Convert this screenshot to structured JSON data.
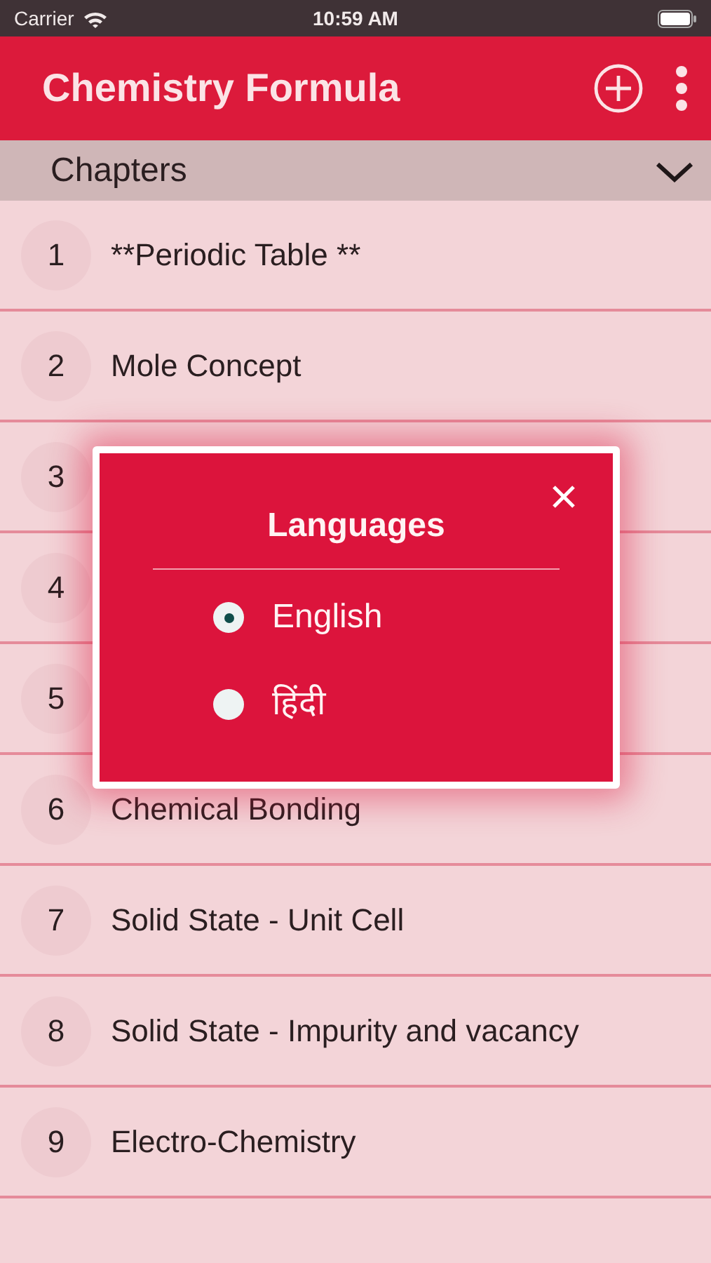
{
  "status_bar": {
    "carrier": "Carrier",
    "time": "10:59 AM"
  },
  "app_bar": {
    "title": "Chemistry Formula"
  },
  "section": {
    "title": "Chapters",
    "expanded": true
  },
  "chapters": [
    {
      "number": "1",
      "title": "**Periodic Table **"
    },
    {
      "number": "2",
      "title": "Mole Concept"
    },
    {
      "number": "3"
    },
    {
      "number": "4"
    },
    {
      "number": "5"
    },
    {
      "number": "6",
      "title": "Chemical Bonding"
    },
    {
      "number": "7",
      "title": "Solid State - Unit Cell"
    },
    {
      "number": "8",
      "title": "Solid State - Impurity and vacancy"
    },
    {
      "number": "9",
      "title": "Electro-Chemistry"
    }
  ],
  "dialog": {
    "title": "Languages",
    "options": [
      {
        "label": "English",
        "selected": true
      },
      {
        "label": "हिंदी",
        "selected": false
      }
    ]
  }
}
